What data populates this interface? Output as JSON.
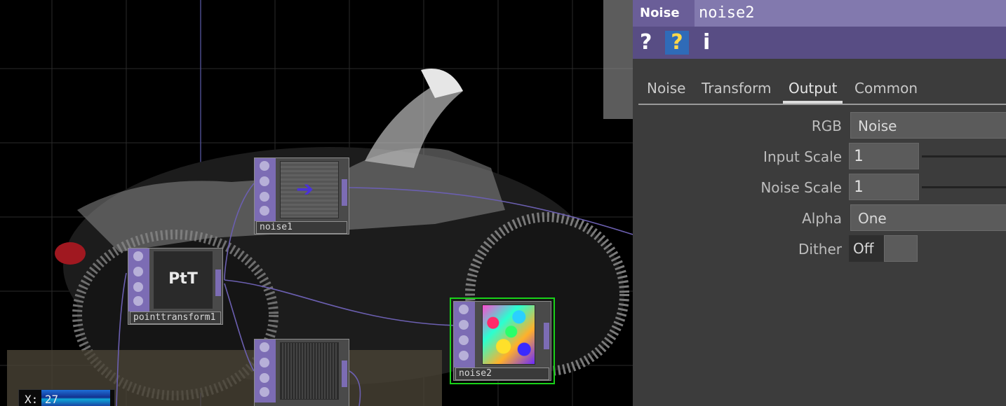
{
  "network": {
    "operators": [
      {
        "name": "noise1"
      },
      {
        "name": "pointtransform1",
        "badge": "PtT"
      },
      {
        "name": "noise2"
      },
      {
        "name": ""
      }
    ],
    "coord_readout": "X: 27"
  },
  "params": {
    "op_type": "Noise",
    "op_name": "noise2",
    "toolbar": {
      "help": "?",
      "python_help": "?",
      "info": "i"
    },
    "tabs": [
      "Noise",
      "Transform",
      "Output",
      "Common"
    ],
    "active_tab": "Output",
    "fields": {
      "rgb": {
        "label": "RGB",
        "value": "Noise"
      },
      "input_scale": {
        "label": "Input Scale",
        "value": "1"
      },
      "noise_scale": {
        "label": "Noise Scale",
        "value": "1"
      },
      "alpha": {
        "label": "Alpha",
        "value": "One"
      },
      "dither": {
        "label": "Dither",
        "value": "Off"
      }
    }
  },
  "colors": {
    "header": "#6a5e98",
    "operator_strip": "#7c6cb4",
    "selection": "#19d219",
    "panel_bg": "#3c3c3c"
  }
}
